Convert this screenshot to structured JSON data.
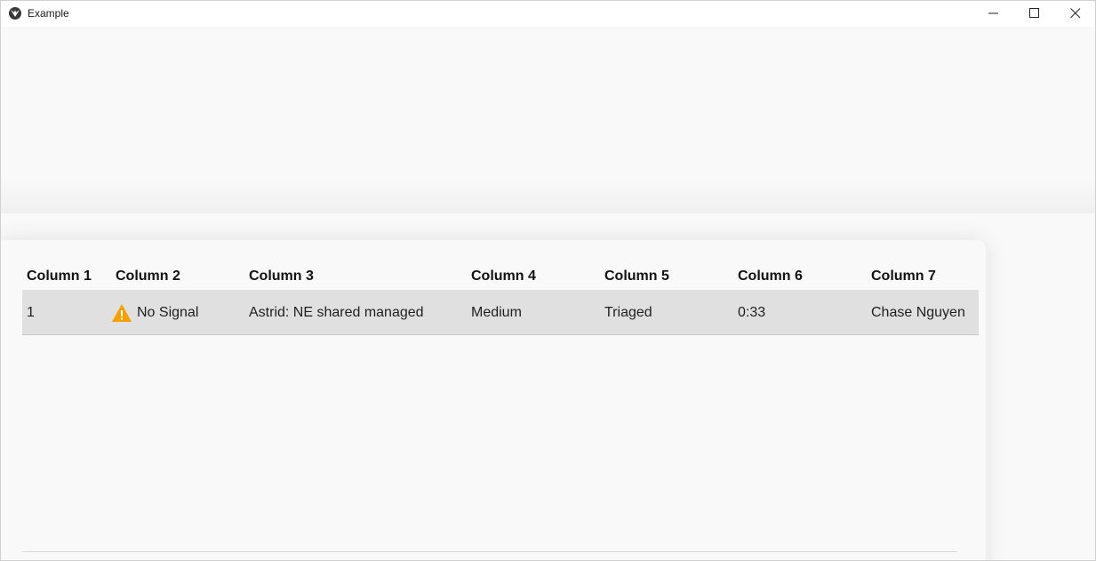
{
  "window": {
    "title": "Example",
    "icon": "kivy-logo-icon"
  },
  "titlebar_buttons": {
    "minimize": "minimize-icon",
    "maximize": "maximize-icon",
    "close": "close-icon"
  },
  "table": {
    "columns": [
      "Column 1",
      "Column 2",
      "Column 3",
      "Column 4",
      "Column 5",
      "Column 6",
      "Column 7"
    ],
    "rows": [
      {
        "col1": "1",
        "col2_icon": "warning-icon",
        "col2": "No Signal",
        "col3": "Astrid: NE shared managed",
        "col4": "Medium",
        "col5": "Triaged",
        "col6": "0:33",
        "col7": "Chase Nguyen"
      }
    ]
  },
  "colors": {
    "warning": "#f5a000",
    "row_highlight": "#e0e0e0",
    "background": "#f9f9f9"
  }
}
